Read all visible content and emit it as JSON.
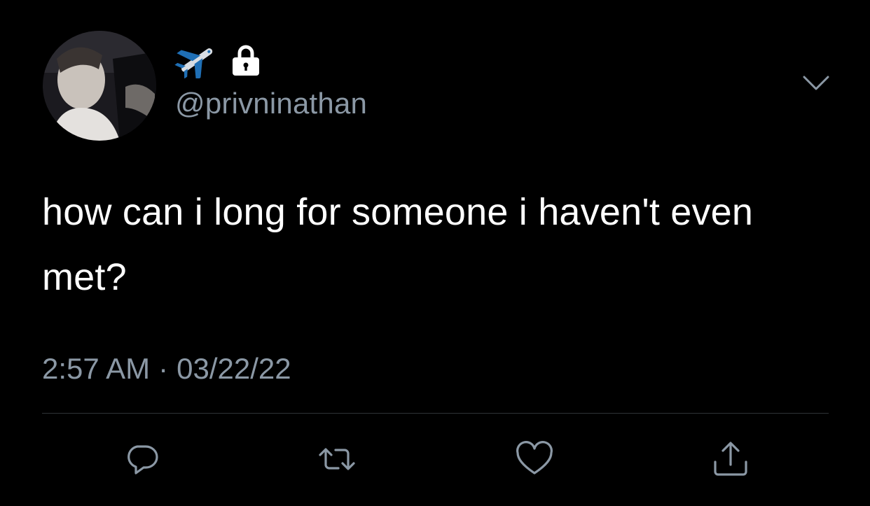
{
  "tweet": {
    "handle": "@privninathan",
    "text": "how can i long for someone i haven't even met?",
    "time": "2:57 AM",
    "separator": "·",
    "date": "03/22/22"
  },
  "icons": {
    "name_emojis": [
      "airplane-icon",
      "lock-icon"
    ],
    "menu": "chevron-down-icon",
    "actions": [
      "reply-icon",
      "retweet-icon",
      "like-icon",
      "share-icon"
    ]
  },
  "colors": {
    "background": "#000000",
    "text": "#ffffff",
    "secondary": "#8b98a5",
    "divider": "#2f3336"
  }
}
